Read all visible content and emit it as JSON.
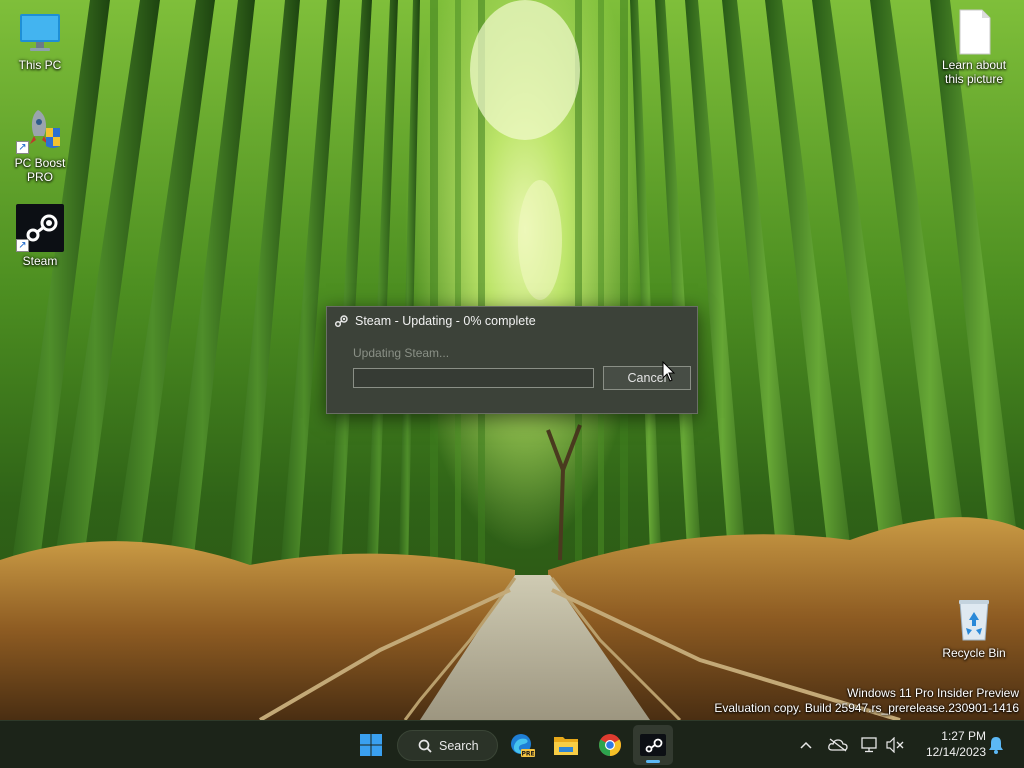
{
  "desktop": {
    "icons": [
      {
        "label": "This PC"
      },
      {
        "label": "PC Boost PRO"
      },
      {
        "label": "Steam"
      },
      {
        "label": "Learn about this picture"
      },
      {
        "label": "Recycle Bin"
      }
    ]
  },
  "watermark": {
    "line1": "Windows 11 Pro Insider Preview",
    "line2": "Evaluation copy. Build 25947.rs_prerelease.230901-1416"
  },
  "dialog": {
    "title": "Steam - Updating - 0% complete",
    "status": "Updating Steam...",
    "progress_percent": 0,
    "cancel_label": "Cancel"
  },
  "taskbar": {
    "search_label": "Search",
    "apps": [
      {
        "icon": "windows-start-icon"
      },
      {
        "icon": "edge-preview-icon",
        "badge": "PRE"
      },
      {
        "icon": "file-explorer-icon"
      },
      {
        "icon": "chrome-icon"
      },
      {
        "icon": "steam-icon",
        "active": true
      }
    ],
    "tray": {
      "icons": [
        "chevron-up-icon",
        "onedrive-off-icon",
        "network-icon",
        "volume-muted-icon",
        "notification-bell-icon"
      ]
    },
    "clock": {
      "time": "1:27 PM",
      "date": "12/14/2023"
    }
  },
  "colors": {
    "dialog_bg": "#3c4239",
    "taskbar_bg": "#1c2419",
    "accent": "#5cb8f5"
  }
}
